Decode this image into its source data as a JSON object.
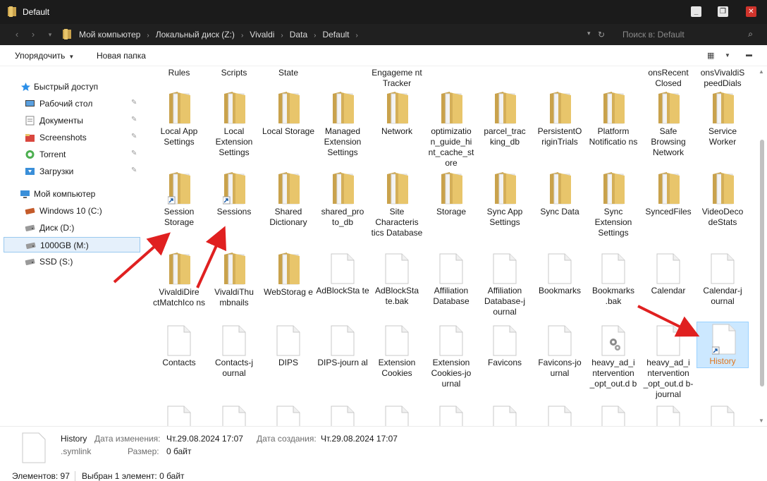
{
  "window": {
    "title": "Default"
  },
  "address": {
    "breadcrumbs": [
      "Мой компьютер",
      "Локальный диск (Z:)",
      "Vivaldi",
      "Data",
      "Default"
    ],
    "search_placeholder": "Поиск в: Default"
  },
  "toolbar": {
    "organize": "Упорядочить",
    "new_folder": "Новая папка"
  },
  "sidebar": {
    "quick_access": "Быстрый доступ",
    "pinned": [
      {
        "label": "Рабочий стол",
        "icon": "desktop-icon"
      },
      {
        "label": "Документы",
        "icon": "documents-icon"
      },
      {
        "label": "Screenshots",
        "icon": "folder-icon"
      },
      {
        "label": "Torrent",
        "icon": "torrent-icon"
      },
      {
        "label": "Загрузки",
        "icon": "downloads-icon"
      }
    ],
    "computer": "Мой компьютер",
    "drives": [
      {
        "label": "Windows 10 (C:)",
        "icon": "system-drive-icon",
        "selected": false
      },
      {
        "label": "Диск (D:)",
        "icon": "drive-icon",
        "selected": false
      },
      {
        "label": "1000GB (M:)",
        "icon": "drive-icon",
        "selected": true
      },
      {
        "label": "SSD (S:)",
        "icon": "drive-icon",
        "selected": false
      }
    ]
  },
  "items_partial_row": [
    "Rules",
    "Scripts",
    "State",
    "",
    "Engageme nt Tracker",
    "",
    "",
    "",
    "",
    "onsRecent Closed",
    "onsVivaldiS peedDials"
  ],
  "items": [
    [
      {
        "name": "Local App Settings",
        "type": "folder"
      },
      {
        "name": "Local Extension Settings",
        "type": "folder"
      },
      {
        "name": "Local Storage",
        "type": "folder"
      },
      {
        "name": "Managed Extension Settings",
        "type": "folder"
      },
      {
        "name": "Network",
        "type": "folder"
      },
      {
        "name": "optimizatio n_guide_hi nt_cache_st ore",
        "type": "folder"
      },
      {
        "name": "parcel_trac king_db",
        "type": "folder"
      },
      {
        "name": "PersistentO riginTrials",
        "type": "folder"
      },
      {
        "name": "Platform Notificatio ns",
        "type": "folder"
      },
      {
        "name": "Safe Browsing Network",
        "type": "folder"
      },
      {
        "name": "Service Worker",
        "type": "folder"
      }
    ],
    [
      {
        "name": "Session Storage",
        "type": "folder-link"
      },
      {
        "name": "Sessions",
        "type": "folder-link"
      },
      {
        "name": "Shared Dictionary",
        "type": "folder"
      },
      {
        "name": "shared_pro to_db",
        "type": "folder"
      },
      {
        "name": "Site Characteris tics Database",
        "type": "folder"
      },
      {
        "name": "Storage",
        "type": "folder"
      },
      {
        "name": "Sync App Settings",
        "type": "folder"
      },
      {
        "name": "Sync Data",
        "type": "folder"
      },
      {
        "name": "Sync Extension Settings",
        "type": "folder"
      },
      {
        "name": "SyncedFiles",
        "type": "folder"
      },
      {
        "name": "VideoDeco deStats",
        "type": "folder"
      }
    ],
    [
      {
        "name": "VivaldiDire ctMatchIco ns",
        "type": "folder"
      },
      {
        "name": "VivaldiThu mbnails",
        "type": "folder"
      },
      {
        "name": "WebStorag e",
        "type": "folder"
      },
      {
        "name": "AdBlockSta te",
        "type": "file"
      },
      {
        "name": "AdBlockSta te.bak",
        "type": "file"
      },
      {
        "name": "Affiliation Database",
        "type": "file"
      },
      {
        "name": "Affiliation Database-j ournal",
        "type": "file"
      },
      {
        "name": "Bookmarks",
        "type": "file"
      },
      {
        "name": "Bookmarks .bak",
        "type": "file"
      },
      {
        "name": "Calendar",
        "type": "file"
      },
      {
        "name": "Calendar-j ournal",
        "type": "file"
      }
    ],
    [
      {
        "name": "Contacts",
        "type": "file"
      },
      {
        "name": "Contacts-j ournal",
        "type": "file"
      },
      {
        "name": "DIPS",
        "type": "file"
      },
      {
        "name": "DIPS-journ al",
        "type": "file"
      },
      {
        "name": "Extension Cookies",
        "type": "file"
      },
      {
        "name": "Extension Cookies-jo urnal",
        "type": "file"
      },
      {
        "name": "Favicons",
        "type": "file"
      },
      {
        "name": "Favicons-jo urnal",
        "type": "file"
      },
      {
        "name": "heavy_ad_i ntervention _opt_out.d b",
        "type": "file-gear"
      },
      {
        "name": "heavy_ad_i ntervention _opt_out.d b-journal",
        "type": "file"
      },
      {
        "name": "History",
        "type": "file-link",
        "selected": true
      }
    ]
  ],
  "details": {
    "name": "History",
    "type": ".symlink",
    "modified_label": "Дата изменения:",
    "modified_value": "Чт.29.08.2024 17:07",
    "created_label": "Дата создания:",
    "created_value": "Чт.29.08.2024 17:07",
    "size_label": "Размер:",
    "size_value": "0 байт"
  },
  "status": {
    "count": "Элементов: 97",
    "selection": "Выбран 1 элемент: 0 байт"
  },
  "colors": {
    "titlebar": "#1b1b1b",
    "addressbar": "#202020",
    "selection": "#cce8ff",
    "selected_label": "#e0761d",
    "annotation_arrow": "#e02020",
    "folder": "#e8c56b"
  }
}
